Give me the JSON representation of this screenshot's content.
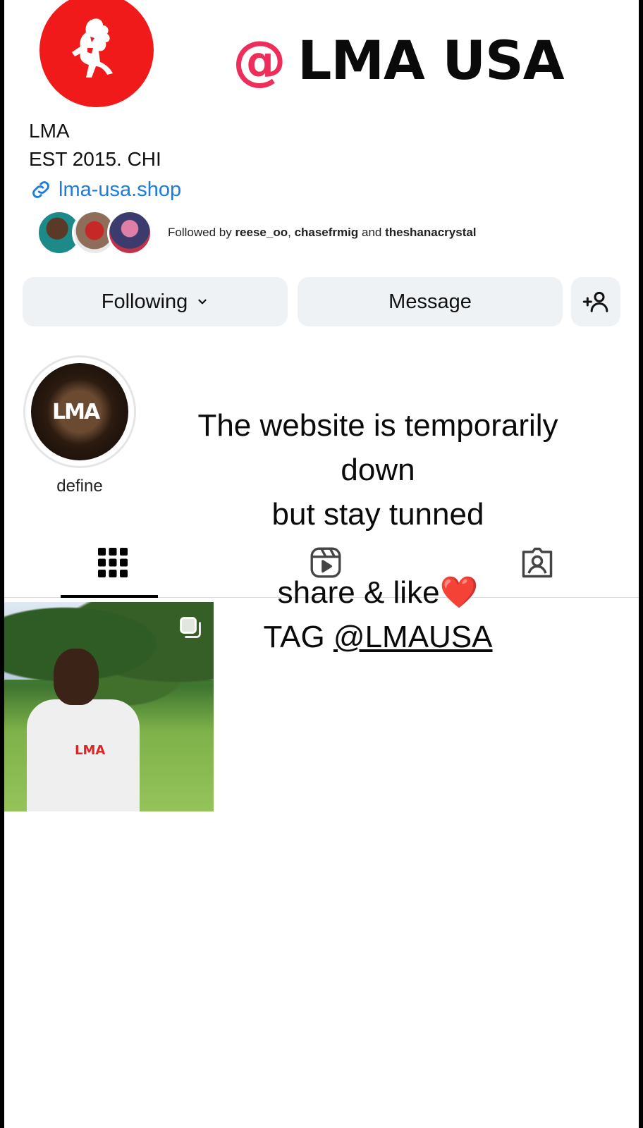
{
  "overlay": {
    "at_sign": "@",
    "brand": "LMA USA",
    "message": {
      "line1": "The website is temporarily",
      "line2": "down",
      "line3": "but stay tunned",
      "line4": "share & like",
      "line4_emoji": "❤️",
      "line5_prefix": "TAG ",
      "line5_tag": "@LMAUSA"
    }
  },
  "profile": {
    "name": "LMA",
    "bio": "EST 2015. CHI",
    "link": "lma-usa.shop",
    "followers": {
      "prefix": "Followed by ",
      "user1": "reese_oo",
      "sep": ", ",
      "user2": "chasefrmig",
      "and": " and ",
      "user3": "theshanacrystal"
    }
  },
  "actions": {
    "following_label": "Following",
    "message_label": "Message"
  },
  "highlight": {
    "logo_text": "LMA",
    "label": "define"
  },
  "post": {
    "shirt_logo": "LMA"
  },
  "icons": {
    "link": "link-icon",
    "chevron": "chevron-down-icon",
    "add_user": "add-user-icon",
    "grid": "grid-icon",
    "reels": "reels-icon",
    "tagged": "tagged-icon",
    "multi": "multi-photo-icon",
    "lion": "lion-logo-icon"
  },
  "colors": {
    "brand_red": "#f01a1a",
    "at_pink": "#ee2d5b",
    "link_blue": "#1a7be0",
    "button_bg": "#eff2f5"
  }
}
